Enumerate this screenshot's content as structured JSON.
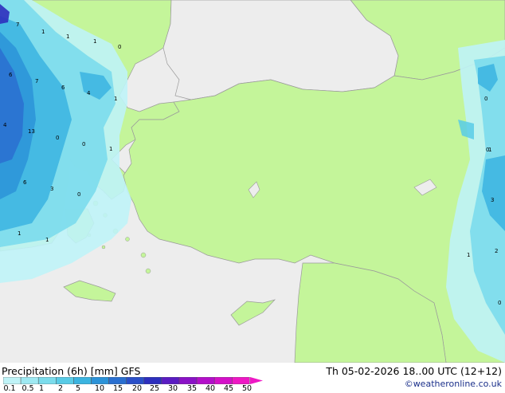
{
  "footer": {
    "title": "Precipitation (6h) [mm] GFS",
    "time": "Th 05-02-2026 18..00 UTC (12+12)",
    "credit": "©weatheronline.co.uk"
  },
  "legend": {
    "labels": [
      "0.1",
      "0.5",
      "1",
      "2",
      "5",
      "10",
      "15",
      "20",
      "25",
      "30",
      "35",
      "40",
      "45",
      "50"
    ],
    "colors": [
      "#bff3f7",
      "#9ee9f2",
      "#7bdcec",
      "#58cbe6",
      "#3bb4e0",
      "#2c93d8",
      "#2a6fd0",
      "#2a4fc8",
      "#2d2fbd",
      "#5a1cc2",
      "#8a12c6",
      "#b30fc9",
      "#d410c8",
      "#ee18c4"
    ]
  },
  "map_values": [
    "7",
    "1",
    "1",
    "1",
    "0",
    "0",
    "6",
    "7",
    "6",
    "4",
    "1",
    "4",
    "13",
    "0",
    "0",
    "1",
    "6",
    "3",
    "0",
    "1",
    "1",
    "0",
    "1",
    "3",
    "1",
    "2",
    "0"
  ],
  "colors": {
    "land": "#c4f59a",
    "outside_land": "#e6e6e6",
    "sea": "#ededed",
    "border": "#9a9a9a"
  }
}
